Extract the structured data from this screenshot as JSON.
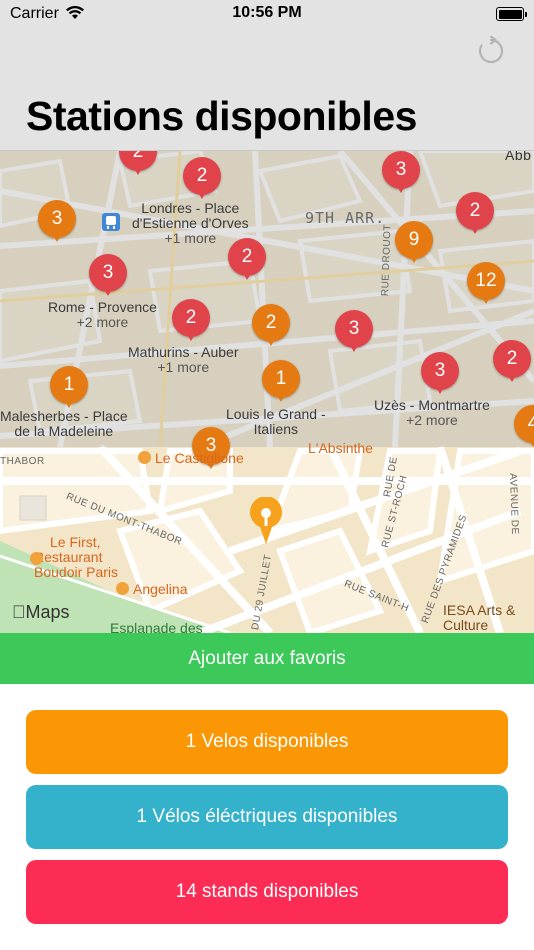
{
  "status_bar": {
    "carrier": "Carrier",
    "time": "10:56 PM"
  },
  "header": {
    "title": "Stations disponibles",
    "refresh_icon": "refresh-icon"
  },
  "map": {
    "stations": [
      {
        "count": "2",
        "color": "red"
      },
      {
        "count": "2",
        "color": "red"
      },
      {
        "count": "3",
        "color": "red"
      },
      {
        "count": "3",
        "color": "orange"
      },
      {
        "count": "2",
        "color": "red"
      },
      {
        "count": "9",
        "color": "orange"
      },
      {
        "count": "2",
        "color": "red"
      },
      {
        "count": "3",
        "color": "red"
      },
      {
        "count": "2",
        "color": "red"
      },
      {
        "count": "2",
        "color": "orange"
      },
      {
        "count": "3",
        "color": "red"
      },
      {
        "count": "12",
        "color": "orange"
      },
      {
        "count": "3",
        "color": "red"
      },
      {
        "count": "2",
        "color": "red"
      },
      {
        "count": "1",
        "color": "orange"
      },
      {
        "count": "1",
        "color": "orange"
      },
      {
        "count": "3",
        "color": "orange"
      },
      {
        "count": "4",
        "color": "orange"
      }
    ],
    "station_labels": [
      {
        "name": "Londres - Place\nd'Estienne d'Orves",
        "more": "+1 more"
      },
      {
        "name": "Rome - Provence",
        "more": "+2 more"
      },
      {
        "name": "Mathurins - Auber",
        "more": "+1 more"
      },
      {
        "name": "Malesherbes - Place\nde la Madeleine",
        "more": ""
      },
      {
        "name": "Louis le Grand -\nItaliens",
        "more": ""
      },
      {
        "name": "Uzès - Montmartre",
        "more": "+2 more"
      }
    ],
    "district": "9TH ARR.",
    "edge_labels": [
      "Abb"
    ],
    "streets": [
      "RUE DROUOT",
      "RUE DU MONT-THABOR",
      "THABOR",
      "DU 29 JUILLET",
      "RUE SAINT-H",
      "RUE ST-ROCH",
      "RUE DES PYRAMIDES",
      "AVENUE DE",
      "RUE DE"
    ],
    "pois": {
      "castiglione": "Le Castiglione",
      "absinthe": "L'Absinthe",
      "le_first": "Le First,\nRestaurant\nBoudoir Paris",
      "angelina": "Angelina",
      "esplanade": "Esplanade des",
      "iesa": "IESA Arts &\nCulture"
    },
    "attribution": "Maps"
  },
  "actions": {
    "favorite": "Ajouter aux favoris",
    "bikes": "1 Velos disponibles",
    "ebikes": "1 Vélos éléctriques disponibles",
    "stands": "14 stands disponibles"
  },
  "colors": {
    "favorite": "#3cc95a",
    "bikes": "#fb9704",
    "ebikes": "#35b2cb",
    "stands": "#fc2c55",
    "pin_red": "#e0444a",
    "pin_orange": "#e57a12"
  }
}
